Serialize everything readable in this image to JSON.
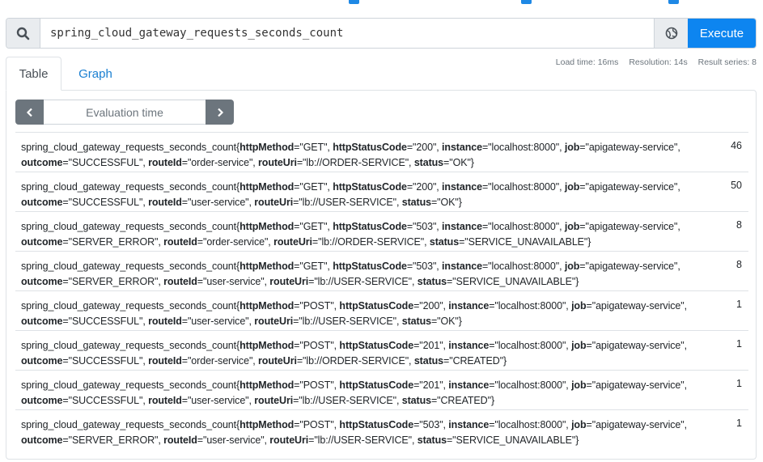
{
  "query": {
    "value": "spring_cloud_gateway_requests_seconds_count",
    "execute_label": "Execute"
  },
  "stats": {
    "load_time": "Load time: 16ms",
    "resolution": "Resolution: 14s",
    "result_series": "Result series: 8"
  },
  "tabs": {
    "table": "Table",
    "graph": "Graph"
  },
  "eval_time": {
    "placeholder": "Evaluation time"
  },
  "results": [
    {
      "metric": "spring_cloud_gateway_requests_seconds_count",
      "labels": [
        {
          "k": "httpMethod",
          "v": "GET"
        },
        {
          "k": "httpStatusCode",
          "v": "200"
        },
        {
          "k": "instance",
          "v": "localhost:8000"
        },
        {
          "k": "job",
          "v": "apigateway-service"
        },
        {
          "k": "outcome",
          "v": "SUCCESSFUL"
        },
        {
          "k": "routeId",
          "v": "order-service"
        },
        {
          "k": "routeUri",
          "v": "lb://ORDER-SERVICE"
        },
        {
          "k": "status",
          "v": "OK"
        }
      ],
      "value": "46"
    },
    {
      "metric": "spring_cloud_gateway_requests_seconds_count",
      "labels": [
        {
          "k": "httpMethod",
          "v": "GET"
        },
        {
          "k": "httpStatusCode",
          "v": "200"
        },
        {
          "k": "instance",
          "v": "localhost:8000"
        },
        {
          "k": "job",
          "v": "apigateway-service"
        },
        {
          "k": "outcome",
          "v": "SUCCESSFUL"
        },
        {
          "k": "routeId",
          "v": "user-service"
        },
        {
          "k": "routeUri",
          "v": "lb://USER-SERVICE"
        },
        {
          "k": "status",
          "v": "OK"
        }
      ],
      "value": "50"
    },
    {
      "metric": "spring_cloud_gateway_requests_seconds_count",
      "labels": [
        {
          "k": "httpMethod",
          "v": "GET"
        },
        {
          "k": "httpStatusCode",
          "v": "503"
        },
        {
          "k": "instance",
          "v": "localhost:8000"
        },
        {
          "k": "job",
          "v": "apigateway-service"
        },
        {
          "k": "outcome",
          "v": "SERVER_ERROR"
        },
        {
          "k": "routeId",
          "v": "order-service"
        },
        {
          "k": "routeUri",
          "v": "lb://ORDER-SERVICE"
        },
        {
          "k": "status",
          "v": "SERVICE_UNAVAILABLE"
        }
      ],
      "value": "8"
    },
    {
      "metric": "spring_cloud_gateway_requests_seconds_count",
      "labels": [
        {
          "k": "httpMethod",
          "v": "GET"
        },
        {
          "k": "httpStatusCode",
          "v": "503"
        },
        {
          "k": "instance",
          "v": "localhost:8000"
        },
        {
          "k": "job",
          "v": "apigateway-service"
        },
        {
          "k": "outcome",
          "v": "SERVER_ERROR"
        },
        {
          "k": "routeId",
          "v": "user-service"
        },
        {
          "k": "routeUri",
          "v": "lb://USER-SERVICE"
        },
        {
          "k": "status",
          "v": "SERVICE_UNAVAILABLE"
        }
      ],
      "value": "8"
    },
    {
      "metric": "spring_cloud_gateway_requests_seconds_count",
      "labels": [
        {
          "k": "httpMethod",
          "v": "POST"
        },
        {
          "k": "httpStatusCode",
          "v": "200"
        },
        {
          "k": "instance",
          "v": "localhost:8000"
        },
        {
          "k": "job",
          "v": "apigateway-service"
        },
        {
          "k": "outcome",
          "v": "SUCCESSFUL"
        },
        {
          "k": "routeId",
          "v": "user-service"
        },
        {
          "k": "routeUri",
          "v": "lb://USER-SERVICE"
        },
        {
          "k": "status",
          "v": "OK"
        }
      ],
      "value": "1"
    },
    {
      "metric": "spring_cloud_gateway_requests_seconds_count",
      "labels": [
        {
          "k": "httpMethod",
          "v": "POST"
        },
        {
          "k": "httpStatusCode",
          "v": "201"
        },
        {
          "k": "instance",
          "v": "localhost:8000"
        },
        {
          "k": "job",
          "v": "apigateway-service"
        },
        {
          "k": "outcome",
          "v": "SUCCESSFUL"
        },
        {
          "k": "routeId",
          "v": "order-service"
        },
        {
          "k": "routeUri",
          "v": "lb://ORDER-SERVICE"
        },
        {
          "k": "status",
          "v": "CREATED"
        }
      ],
      "value": "1"
    },
    {
      "metric": "spring_cloud_gateway_requests_seconds_count",
      "labels": [
        {
          "k": "httpMethod",
          "v": "POST"
        },
        {
          "k": "httpStatusCode",
          "v": "201"
        },
        {
          "k": "instance",
          "v": "localhost:8000"
        },
        {
          "k": "job",
          "v": "apigateway-service"
        },
        {
          "k": "outcome",
          "v": "SUCCESSFUL"
        },
        {
          "k": "routeId",
          "v": "user-service"
        },
        {
          "k": "routeUri",
          "v": "lb://USER-SERVICE"
        },
        {
          "k": "status",
          "v": "CREATED"
        }
      ],
      "value": "1"
    },
    {
      "metric": "spring_cloud_gateway_requests_seconds_count",
      "labels": [
        {
          "k": "httpMethod",
          "v": "POST"
        },
        {
          "k": "httpStatusCode",
          "v": "503"
        },
        {
          "k": "instance",
          "v": "localhost:8000"
        },
        {
          "k": "job",
          "v": "apigateway-service"
        },
        {
          "k": "outcome",
          "v": "SERVER_ERROR"
        },
        {
          "k": "routeId",
          "v": "user-service"
        },
        {
          "k": "routeUri",
          "v": "lb://USER-SERVICE"
        },
        {
          "k": "status",
          "v": "SERVICE_UNAVAILABLE"
        }
      ],
      "value": "1"
    }
  ]
}
